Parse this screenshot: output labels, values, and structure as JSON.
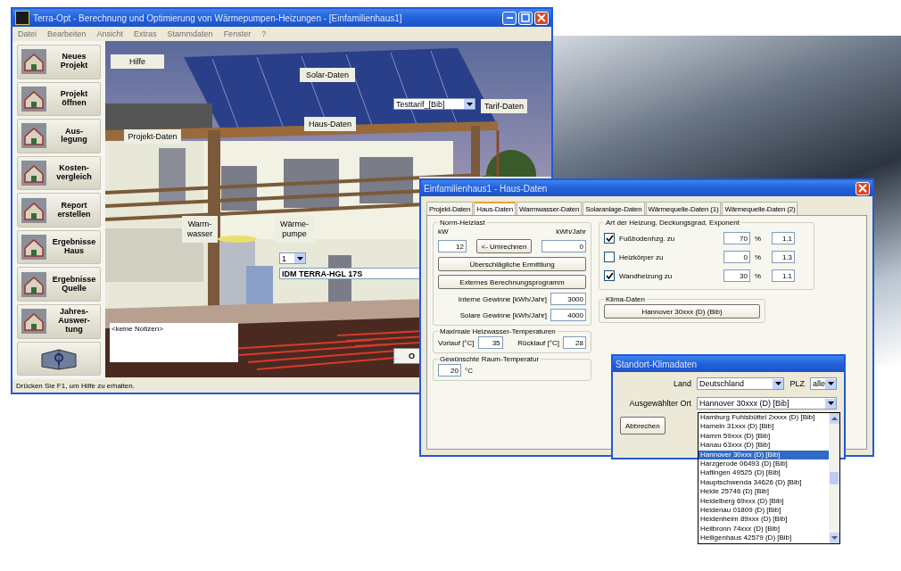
{
  "main_window": {
    "title": "Terra-Opt - Berechnung und Optimierung von Wärmepumpen-Heizungen - [Einfamilienhaus1]",
    "menu": [
      "Datei",
      "Bearbeiten",
      "Ansicht",
      "Extras",
      "Stammdaten",
      "Fenster",
      "?"
    ],
    "sidebar": [
      {
        "kind": "labeled",
        "label": "Neues\nProjekt"
      },
      {
        "kind": "labeled",
        "label": "Projekt\nöffnen"
      },
      {
        "kind": "labeled",
        "label": "Aus-\nlegung"
      },
      {
        "kind": "labeled",
        "label": "Kosten-\nvergleich"
      },
      {
        "kind": "labeled",
        "label": "Report\nerstellen"
      },
      {
        "kind": "labeled",
        "label": "Ergebnisse\nHaus"
      },
      {
        "kind": "labeled",
        "label": "Ergebnisse\nQuelle"
      },
      {
        "kind": "labeled",
        "label": "Jahres-\nAuswer-\ntung"
      },
      {
        "kind": "help"
      }
    ],
    "scene": {
      "labels": [
        {
          "text": "Hilfe"
        },
        {
          "text": "Solar-Daten"
        },
        {
          "text": "Tarif-Daten"
        },
        {
          "text": "Haus-Daten"
        },
        {
          "text": "Projekt-Daten"
        },
        {
          "text": "Warm-\nwasser"
        },
        {
          "text": "Wärme-\npumpe"
        }
      ],
      "tariff_select": "Testtarif_[Bib]",
      "pump_count_select": "1",
      "pump_model_select": "IDM TERRA-HGL 17S",
      "notes": "<keine Notizen>",
      "partial_button": "O"
    },
    "status_bar": "Drücken Sie F1, um Hilfe zu erhalten."
  },
  "house_dialog": {
    "title": "Einfamilienhaus1 - Haus-Daten",
    "tabs": [
      {
        "label": "Projekt-Daten",
        "selected": false
      },
      {
        "label": "Haus-Daten",
        "selected": true
      },
      {
        "label": "Warmwasser-Daten",
        "selected": false
      },
      {
        "label": "Solaranlage-Daten",
        "selected": false
      },
      {
        "label": "Wärmequelle-Daten (1)",
        "selected": false
      },
      {
        "label": "Wärmequelle-Daten (2)",
        "selected": false
      }
    ],
    "heat_load": {
      "title": "Norm-Heizlast",
      "kw_label": "kW",
      "kwh_label": "kWh/Jahr",
      "kw_value": "12",
      "convert_button": "<- Umrechnen",
      "kwh_value": "0",
      "estimate_button": "Überschlägliche Ermittlung",
      "external_button": "Externes Berechnungsprogramm",
      "gains": [
        {
          "label": "Interne Gewinne [kWh/Jahr]",
          "value": "3000"
        },
        {
          "label": "Solare Gewinne [kWh/Jahr]",
          "value": "4000"
        }
      ]
    },
    "water_temps": {
      "title": "Maximale Heizwasser-Temperaturen",
      "flow_label": "Vorlauf [°C]",
      "flow_value": "35",
      "return_label": "Rücklauf [°C]",
      "return_value": "28"
    },
    "room_temp": {
      "title": "Gewünschte Raum-Temperatur",
      "value": "20",
      "unit": "°C"
    },
    "heating": {
      "title": "Art der Heizung, Deckungsgrad, Exponent",
      "rows": [
        {
          "label": "Fußbodenhzg. zu",
          "checked": true,
          "share": "70",
          "unit": "%",
          "exponent": "1.1"
        },
        {
          "label": "Heizkörper zu",
          "checked": false,
          "share": "0",
          "unit": "%",
          "exponent": "1.3"
        },
        {
          "label": "Wandheizung zu",
          "checked": true,
          "share": "30",
          "unit": "%",
          "exponent": "1.1"
        }
      ]
    },
    "climate": {
      "title": "Klima-Daten",
      "button": "Hannover 30xxx (D) (Bib)"
    }
  },
  "climate_dialog": {
    "title": "Standort-Klimadaten",
    "country_label": "Land",
    "country": "Deutschland",
    "zip_label": "PLZ",
    "zip": "alle",
    "place_label": "Ausgewählter Ort",
    "place": "Hannover 30xxx (D) [Bib]",
    "cancel_button": "Abbrechen",
    "places": [
      {
        "label": "Hamburg Fuhlsbüttel 2xxxx (D) [Bib]",
        "selected": false
      },
      {
        "label": "Hameln 31xxx (D) [Bib]",
        "selected": false
      },
      {
        "label": "Hamm 59xxx (D) [Bib]",
        "selected": false
      },
      {
        "label": "Hanau 63xxx (D) [Bib]",
        "selected": false
      },
      {
        "label": "Hannover 30xxx (D) [Bib]",
        "selected": true
      },
      {
        "label": "Harzgerode 06493 (D) [Bib]",
        "selected": false
      },
      {
        "label": "Haflingen 49525 (D) [Bib]",
        "selected": false
      },
      {
        "label": "Hauptschwenda 34626 (D) [Bib]",
        "selected": false
      },
      {
        "label": "Heide 25746 (D) [Bib]",
        "selected": false
      },
      {
        "label": "Heidelberg 69xxx (D) [Bib]",
        "selected": false
      },
      {
        "label": "Heidenau 01809 (D) [Bib]",
        "selected": false
      },
      {
        "label": "Heidenheim 89xxx (D) [Bib]",
        "selected": false
      },
      {
        "label": "Heilbronn 74xxx (D) [Bib]",
        "selected": false
      },
      {
        "label": "Heiligenhaus 42579 (D) [Bib]",
        "selected": false
      }
    ]
  }
}
